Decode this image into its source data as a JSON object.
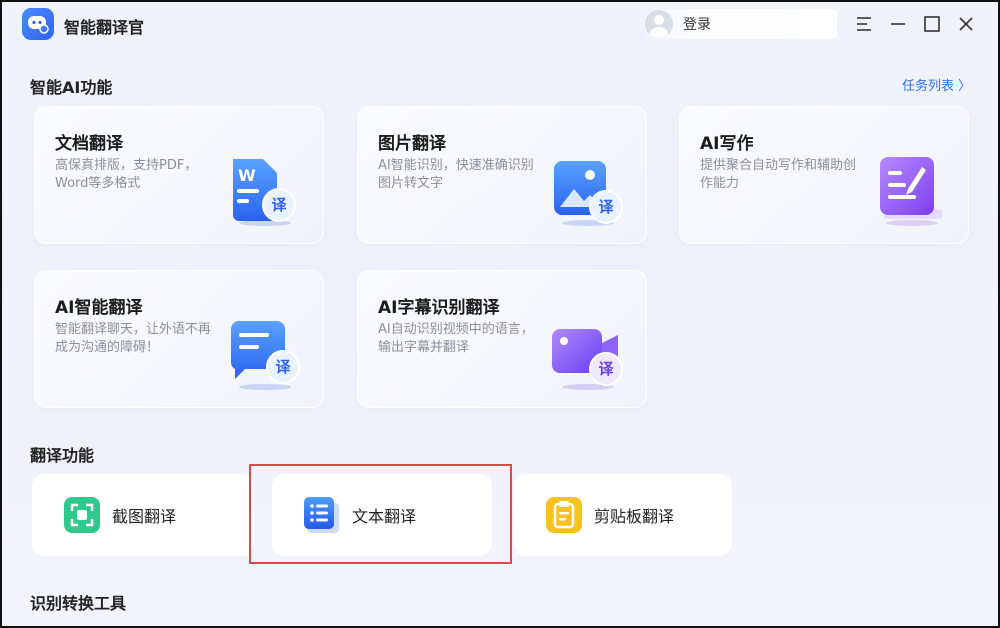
{
  "app": {
    "title": "智能翻译官"
  },
  "header": {
    "login_label": "登录"
  },
  "window_controls": {
    "menu": "☰",
    "minimize": "—",
    "maximize": "☐",
    "close": "✕"
  },
  "ai_section": {
    "title": "智能AI功能",
    "task_list_label": "任务列表 〉",
    "cards": [
      {
        "title": "文档翻译",
        "desc": "高保真排版，支持PDF，Word等多格式",
        "icon": "document-translate-icon",
        "badge": "译"
      },
      {
        "title": "图片翻译",
        "desc": "AI智能识别，快速准确识别图片转文字",
        "icon": "image-translate-icon",
        "badge": "译"
      },
      {
        "title": "AI写作",
        "desc": "提供聚合自动写作和辅助创作能力",
        "icon": "ai-writing-icon"
      },
      {
        "title": "AI智能翻译",
        "desc": "智能翻译聊天，让外语不再成为沟通的障碍！",
        "icon": "chat-translate-icon",
        "badge": "译"
      },
      {
        "title": "AI字幕识别翻译",
        "desc": "AI自动识别视频中的语言，输出字幕并翻译",
        "icon": "subtitle-translate-icon",
        "badge": "译"
      }
    ]
  },
  "translate_section": {
    "title": "翻译功能",
    "tools": [
      {
        "label": "截图翻译",
        "icon": "screenshot-icon"
      },
      {
        "label": "文本翻译",
        "icon": "text-list-icon"
      },
      {
        "label": "剪贴板翻译",
        "icon": "clipboard-icon"
      }
    ]
  },
  "convert_section": {
    "title": "识别转换工具"
  },
  "colors": {
    "accent": "#2f6ef2",
    "highlight": "#d94a4a"
  }
}
